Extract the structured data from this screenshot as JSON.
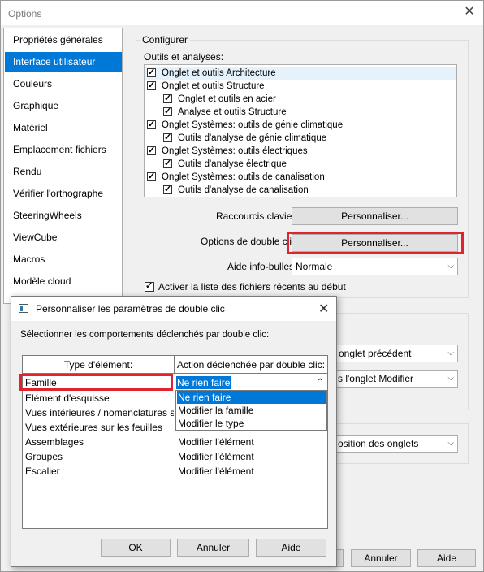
{
  "window": {
    "title": "Options",
    "close_glyph": "✕"
  },
  "sidebar": {
    "items": [
      {
        "label": "Propriétés générales"
      },
      {
        "label": "Interface utilisateur"
      },
      {
        "label": "Couleurs"
      },
      {
        "label": "Graphique"
      },
      {
        "label": "Matériel"
      },
      {
        "label": "Emplacement fichiers"
      },
      {
        "label": "Rendu"
      },
      {
        "label": "Vérifier l'orthographe"
      },
      {
        "label": "SteeringWheels"
      },
      {
        "label": "ViewCube"
      },
      {
        "label": "Macros"
      },
      {
        "label": "Modèle cloud"
      }
    ],
    "selected_index": 1
  },
  "configure": {
    "group_label": "Configurer",
    "tools_label": "Outils et analyses:",
    "tree": [
      {
        "label": "Onglet et outils Architecture",
        "checked": true
      },
      {
        "label": "Onglet et outils Structure",
        "checked": true
      },
      {
        "label": "Onglet et outils en acier",
        "checked": true
      },
      {
        "label": "Analyse et outils Structure",
        "checked": true
      },
      {
        "label": "Onglet Systèmes: outils de génie climatique",
        "checked": true
      },
      {
        "label": "Outils d'analyse de génie climatique",
        "checked": true
      },
      {
        "label": "Onglet Systèmes: outils électriques",
        "checked": true
      },
      {
        "label": "Outils d'analyse électrique",
        "checked": true
      },
      {
        "label": "Onglet Systèmes: outils de canalisation",
        "checked": true
      },
      {
        "label": "Outils d'analyse de canalisation",
        "checked": true
      }
    ],
    "shortcuts_label": "Raccourcis clavier:",
    "shortcuts_button": "Personnaliser...",
    "dblclick_label": "Options de double clic:",
    "dblclick_button": "Personnaliser...",
    "tooltip_label": "Aide info-bulles:",
    "tooltip_value": "Normale",
    "recent_files_label": "Activer la liste des fichiers récents au début",
    "recent_files_checked": true
  },
  "behind": {
    "combo1_value": "onglet précédent",
    "combo2_value": "s l'onglet Modifier",
    "combo3_value": "osition des onglets",
    "ok_fragment": "",
    "cancel_button": "Annuler",
    "help_button": "Aide"
  },
  "dialog": {
    "title": "Personnaliser les paramètres de double clic",
    "close_glyph": "✕",
    "instruction": "Sélectionner les comportements déclenchés par double clic:",
    "col_type": "Type d'élément:",
    "col_action": "Action déclenchée par double clic:",
    "rows": [
      {
        "type": "Famille",
        "action": "Ne rien faire"
      },
      {
        "type": "Elément d'esquisse",
        "action": ""
      },
      {
        "type": "Vues intérieures / nomenclatures s",
        "action": ""
      },
      {
        "type": "Vues extérieures sur les feuilles",
        "action": ""
      },
      {
        "type": "Assemblages",
        "action": "Modifier l'élément"
      },
      {
        "type": "Groupes",
        "action": "Modifier l'élément"
      },
      {
        "type": "Escalier",
        "action": "Modifier l'élément"
      }
    ],
    "dropdown_options": [
      "Ne rien faire",
      "Modifier la famille",
      "Modifier le type"
    ],
    "ok_button": "OK",
    "cancel_button": "Annuler",
    "help_button": "Aide"
  },
  "colors": {
    "selection": "#0078d7",
    "highlight_box": "#e0242c"
  }
}
